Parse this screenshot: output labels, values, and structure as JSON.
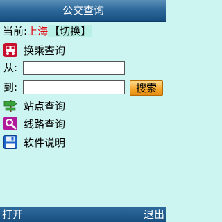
{
  "window": {
    "title": "公交查询"
  },
  "city": {
    "prefix": "当前:",
    "name": "上海",
    "switch_label": "【切换】"
  },
  "transfer": {
    "label": "换乘查询"
  },
  "form": {
    "from_label": "从:",
    "from_value": "",
    "to_label": "到:",
    "to_value": "",
    "search_label": "搜索"
  },
  "menu": [
    {
      "label": "站点查询",
      "icon": "signpost-icon"
    },
    {
      "label": "线路查询",
      "icon": "magnifier-icon"
    },
    {
      "label": "软件说明",
      "icon": "floppy-disk-icon"
    }
  ],
  "softkeys": {
    "left": "打开",
    "right": "退出"
  },
  "colors": {
    "accent": "#e0000b",
    "titlebar": "#2f6a9c",
    "background": "#ccf4f0",
    "button": "#f5a52a"
  }
}
